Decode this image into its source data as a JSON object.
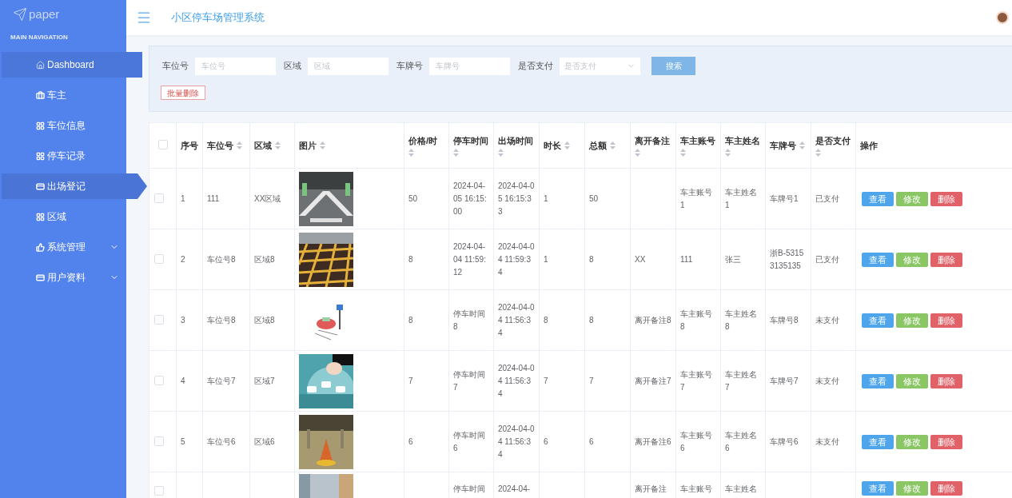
{
  "logo": {
    "text": "paper"
  },
  "sidebar": {
    "heading": "MAIN NAVIGATION",
    "items": [
      {
        "label": "Dashboard",
        "selected": false,
        "highlighted": true
      },
      {
        "label": "车主",
        "selected": false,
        "highlighted": false
      },
      {
        "label": "车位信息",
        "selected": false,
        "highlighted": false
      },
      {
        "label": "停车记录",
        "selected": false,
        "highlighted": false
      },
      {
        "label": "出场登记",
        "selected": true,
        "highlighted": false
      },
      {
        "label": "区域",
        "selected": false,
        "highlighted": false
      },
      {
        "label": "系统管理",
        "selected": false,
        "highlighted": false,
        "expanded": false
      },
      {
        "label": "用户资料",
        "selected": false,
        "highlighted": false,
        "expanded": false
      }
    ]
  },
  "header": {
    "title": "小区停车场管理系统"
  },
  "filters": [
    {
      "kind": "input",
      "label": "车位号",
      "placeholder": "车位号"
    },
    {
      "kind": "input",
      "label": "区域",
      "placeholder": "区域"
    },
    {
      "kind": "input",
      "label": "车牌号",
      "placeholder": "车牌号"
    },
    {
      "kind": "select",
      "label": "是否支付",
      "placeholder": "是否支付"
    }
  ],
  "search_button": "搜索",
  "batch_delete_button": "批量删除",
  "table": {
    "select_all": {
      "checked": false
    },
    "columns": [
      {
        "label": "序号",
        "sortable": false
      },
      {
        "label": "车位号",
        "sortable": true
      },
      {
        "label": "区域",
        "sortable": true
      },
      {
        "label": "图片",
        "sortable": true
      },
      {
        "label": "价格/时",
        "sortable": true
      },
      {
        "label": "停车时间",
        "sortable": true
      },
      {
        "label": "出场时间",
        "sortable": true
      },
      {
        "label": "时长",
        "sortable": true
      },
      {
        "label": "总额",
        "sortable": true
      },
      {
        "label": "离开备注",
        "sortable": true
      },
      {
        "label": "车主账号",
        "sortable": true
      },
      {
        "label": "车主姓名",
        "sortable": true
      },
      {
        "label": "车牌号",
        "sortable": true
      },
      {
        "label": "是否支付",
        "sortable": true
      },
      {
        "label": "操作",
        "sortable": false
      }
    ],
    "rows": [
      {
        "checked": false,
        "cells": [
          "1",
          "111",
          "XX区域",
          {
            "kind": "picture"
          },
          "50",
          "2024-04-05 16:15:00",
          "2024-04-05 16:15:33",
          "1",
          "50",
          null,
          "车主账号1",
          "车主姓名1",
          "车牌号1",
          "已支付"
        ],
        "actions": [
          "查看",
          "修改",
          "删除"
        ]
      },
      {
        "checked": false,
        "cells": [
          "2",
          "车位号8",
          "区域8",
          {
            "kind": "picture"
          },
          "8",
          "2024-04-04 11:59:12",
          "2024-04-04 11:59:34",
          "1",
          "8",
          "XX",
          "111",
          "张三",
          "浙B-53153135135",
          "已支付"
        ],
        "actions": [
          "查看",
          "修改",
          "删除"
        ]
      },
      {
        "checked": false,
        "cells": [
          "3",
          "车位号8",
          "区域8",
          {
            "kind": "picture"
          },
          "8",
          "停车时间8",
          "2024-04-04 11:56:34",
          "8",
          "8",
          "离开备注8",
          "车主账号8",
          "车主姓名8",
          "车牌号8",
          "未支付"
        ],
        "actions": [
          "查看",
          "修改",
          "删除"
        ]
      },
      {
        "checked": false,
        "cells": [
          "4",
          "车位号7",
          "区域7",
          {
            "kind": "picture"
          },
          "7",
          "停车时间7",
          "2024-04-04 11:56:34",
          "7",
          "7",
          "离开备注7",
          "车主账号7",
          "车主姓名7",
          "车牌号7",
          "未支付"
        ],
        "actions": [
          "查看",
          "修改",
          "删除"
        ]
      },
      {
        "checked": false,
        "cells": [
          "5",
          "车位号6",
          "区域6",
          {
            "kind": "picture"
          },
          "6",
          "停车时间6",
          "2024-04-04 11:56:34",
          "6",
          "6",
          "离开备注6",
          "车主账号6",
          "车主姓名6",
          "车牌号6",
          "未支付"
        ],
        "actions": [
          "查看",
          "修改",
          "删除"
        ]
      },
      {
        "checked": false,
        "cells": [
          null,
          null,
          null,
          {
            "kind": "picture"
          },
          null,
          "停车时间",
          "2024-04-",
          null,
          null,
          "离开备注",
          "车主账号",
          "车主姓名",
          null,
          null
        ],
        "actions": [
          "查看",
          "修改",
          "删除"
        ]
      }
    ]
  }
}
